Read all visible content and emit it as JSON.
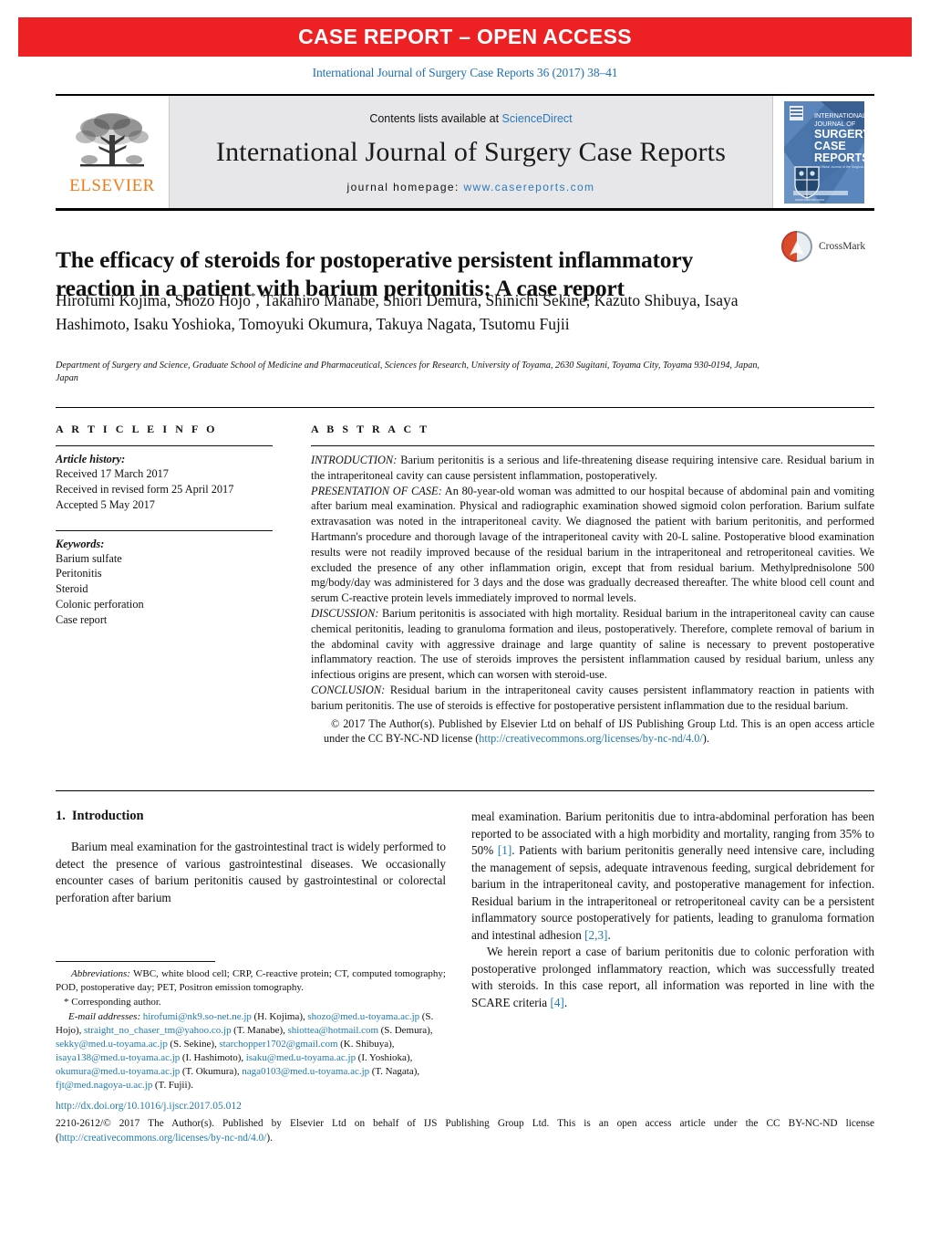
{
  "banner": {
    "text": "CASE REPORT – OPEN ACCESS",
    "color": "#ed2024"
  },
  "citation": "International Journal of Surgery Case Reports 36 (2017) 38–41",
  "masthead": {
    "contents_prefix": "Contents lists available at ",
    "contents_link": "ScienceDirect",
    "journal_name": "International Journal of Surgery Case Reports",
    "homepage_prefix": "journal homepage: ",
    "homepage_url": "www.casereports.com",
    "publisher_wordmark": "ELSEVIER",
    "cover_lines": [
      "INTERNATIONAL",
      "JOURNAL OF",
      "SURGERY",
      "CASE",
      "REPORTS"
    ]
  },
  "article": {
    "title": "The efficacy of steroids for postoperative persistent inflammatory reaction in a patient with barium peritonitis: A case report",
    "crossmark_label": "CrossMark",
    "authors_line1": "Hirofumi Kojima, Shozo Hojo",
    "authors_line1b": ", Takahiro Manabe, Shiori Demura, Shinichi Sekine,",
    "authors_line2": "Kazuto Shibuya, Isaya Hashimoto, Isaku Yoshioka, Tomoyuki Okumura, Takuya Nagata,",
    "authors_line3": "Tsutomu Fujii",
    "corresponding_marker": "*",
    "affiliation": "Department of Surgery and Science, Graduate School of Medicine and Pharmaceutical, Sciences for Research, University of Toyama, 2630 Sugitani, Toyama City, Toyama 930-0194, Japan, Japan"
  },
  "article_info": {
    "heading": "A R T I C L E   I N F O",
    "history_label": "Article history:",
    "history": [
      "Received 17 March 2017",
      "Received in revised form 25 April 2017",
      "Accepted 5 May 2017"
    ],
    "keywords_label": "Keywords:",
    "keywords": [
      "Barium sulfate",
      "Peritonitis",
      "Steroid",
      "Colonic perforation",
      "Case report"
    ]
  },
  "abstract": {
    "heading": "A B S T R A C T",
    "sections": [
      {
        "label": "INTRODUCTION:",
        "text": " Barium peritonitis is a serious and life-threatening disease requiring intensive care. Residual barium in the intraperitoneal cavity can cause persistent inflammation, postoperatively."
      },
      {
        "label": "PRESENTATION OF CASE:",
        "text": " An 80-year-old woman was admitted to our hospital because of abdominal pain and vomiting after barium meal examination. Physical and radiographic examination showed sigmoid colon perforation. Barium sulfate extravasation was noted in the intraperitoneal cavity. We diagnosed the patient with barium peritonitis, and performed Hartmann's procedure and thorough lavage of the intraperitoneal cavity with 20-L saline. Postoperative blood examination results were not readily improved because of the residual barium in the intraperitoneal and retroperitoneal cavities. We excluded the presence of any other inflammation origin, except that from residual barium. Methylprednisolone 500 mg/body/day was administered for 3 days and the dose was gradually decreased thereafter. The white blood cell count and serum C-reactive protein levels immediately improved to normal levels."
      },
      {
        "label": "DISCUSSION:",
        "text": " Barium peritonitis is associated with high mortality. Residual barium in the intraperitoneal cavity can cause chemical peritonitis, leading to granuloma formation and ileus, postoperatively. Therefore, complete removal of barium in the abdominal cavity with aggressive drainage and large quantity of saline is necessary to prevent postoperative inflammatory reaction. The use of steroids improves the persistent inflammation caused by residual barium, unless any infectious origins are present, which can worsen with steroid-use."
      },
      {
        "label": "CONCLUSION:",
        "text": " Residual barium in the intraperitoneal cavity causes persistent inflammatory reaction in patients with barium peritonitis. The use of steroids is effective for postoperative persistent inflammation due to the residual barium."
      }
    ],
    "copyright_text": "© 2017 The Author(s). Published by Elsevier Ltd on behalf of IJS Publishing Group Ltd. This is an open access article under the CC BY-NC-ND license (",
    "copyright_link": "http://creativecommons.org/licenses/by-nc-nd/4.0/",
    "copyright_suffix": ")."
  },
  "introduction": {
    "number": "1.",
    "heading": "Introduction",
    "para1_left": "Barium meal examination for the gastrointestinal tract is widely performed to detect the presence of various gastrointestinal diseases. We occasionally encounter cases of barium peritonitis caused by gastrointestinal or colorectal perforation after barium",
    "para1_right_a": "meal examination. Barium peritonitis due to intra-abdominal perforation has been reported to be associated with a high morbidity and mortality, ranging from 35% to 50% ",
    "cite1": "[1]",
    "para1_right_b": ". Patients with barium peritonitis generally need intensive care, including the management of sepsis, adequate intravenous feeding, surgical debridement for barium in the intraperitoneal cavity, and postoperative management for infection. Residual barium in the intraperitoneal or retroperitoneal cavity can be a persistent inflammatory source postoperatively for patients, leading to granuloma formation and intestinal adhesion ",
    "cite2": "[2,3]",
    "para1_right_c": ".",
    "para2_a": "We herein report a case of barium peritonitis due to colonic perforation with postoperative prolonged inflammatory reaction, which was successfully treated with steroids. In this case report, all information was reported in line with the SCARE criteria ",
    "cite3": "[4]",
    "para2_b": "."
  },
  "footnotes": {
    "abbrev_label": "Abbreviations:",
    "abbrev_text": "  WBC, white blood cell; CRP, C-reactive protein; CT, computed tomography; POD, postoperative day; PET, Positron emission tomography.",
    "corresponding_marker": "*",
    "corresponding_text": " Corresponding author.",
    "email_label": "E-mail addresses:",
    "emails": [
      {
        "addr": "hirofumi@nk9.so-net.ne.jp",
        "name": " (H. Kojima), "
      },
      {
        "addr": "shozo@med.u-toyama.ac.jp",
        "name": " (S. Hojo), "
      },
      {
        "addr": "straight_no_chaser_tm@yahoo.co.jp",
        "name": " (T. Manabe), "
      },
      {
        "addr": "shiottea@hotmail.com",
        "name": " (S. Demura), "
      },
      {
        "addr": "sekky@med.u-toyama.ac.jp",
        "name": " (S. Sekine), "
      },
      {
        "addr": "starchopper1702@gmail.com",
        "name": " (K. Shibuya), "
      },
      {
        "addr": "isaya138@med.u-toyama.ac.jp",
        "name": " (I. Hashimoto), "
      },
      {
        "addr": "isaku@med.u-toyama.ac.jp",
        "name": " (I. Yoshioka), "
      },
      {
        "addr": "okumura@med.u-toyama.ac.jp",
        "name": " (T. Okumura), "
      },
      {
        "addr": "naga0103@med.u-toyama.ac.jp",
        "name": " (T. Nagata), "
      },
      {
        "addr": "fjt@med.nagoya-u.ac.jp",
        "name": " (T. Fujii)."
      }
    ]
  },
  "footer": {
    "doi": "http://dx.doi.org/10.1016/j.ijscr.2017.05.012",
    "issn_copyright": "2210-2612/© 2017 The Author(s). Published by Elsevier Ltd on behalf of IJS Publishing Group Ltd. This is an open access article under the CC BY-NC-ND license (",
    "license_link": "http://creativecommons.org/licenses/by-nc-nd/4.0/",
    "license_suffix": ")."
  }
}
